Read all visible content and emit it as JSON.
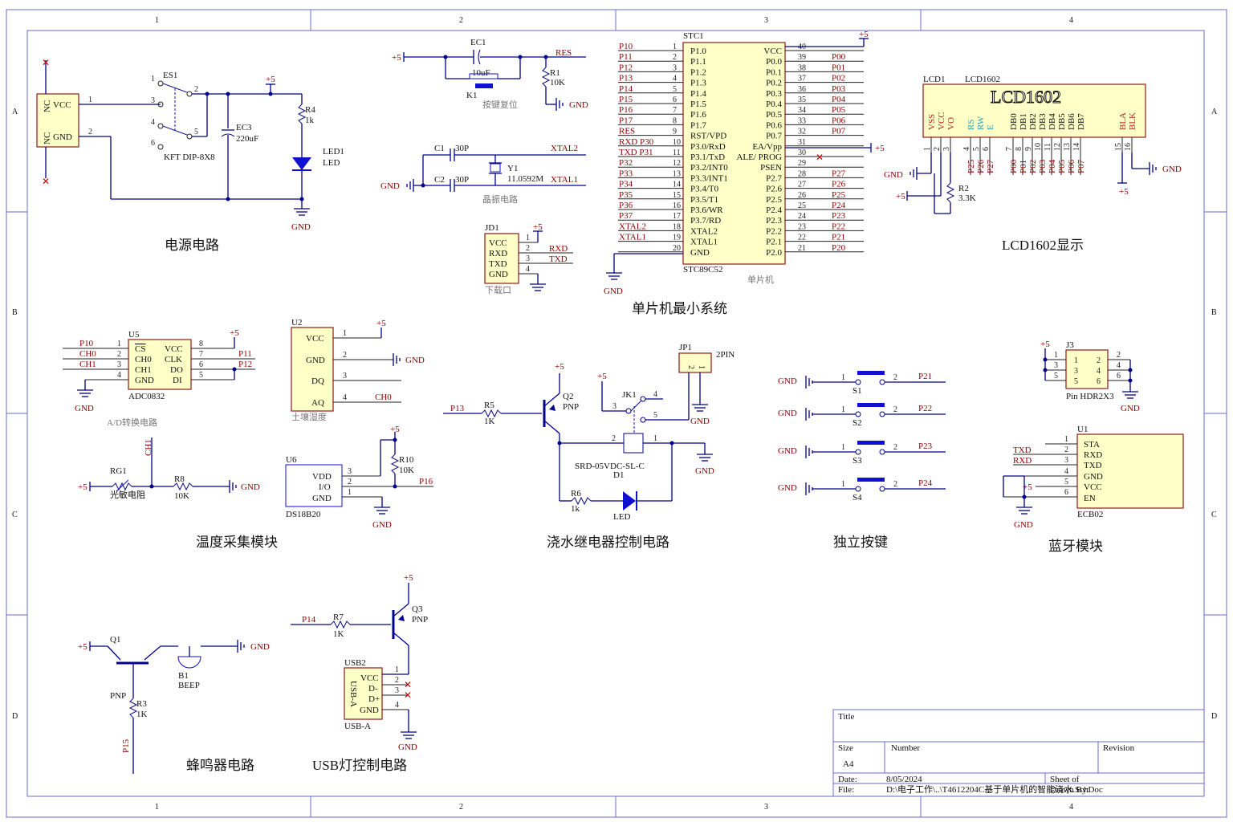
{
  "zones": {
    "cols": [
      "1",
      "2",
      "3",
      "4"
    ],
    "rows": [
      "A",
      "B",
      "C",
      "D"
    ]
  },
  "sections": {
    "power": "电源电路",
    "mcu": "单片机最小系统",
    "lcd": "LCD1602显示",
    "temp": "温度采集模块",
    "relay": "浇水继电器控制电路",
    "keys": "独立按键",
    "bt": "蓝牙模块",
    "buzzer": "蜂鸣器电路",
    "usb": "USB灯控制电路",
    "adc_hint": "A/D转换电路",
    "crystal_hint": "晶振电路",
    "reset_hint": "按键复位",
    "mcu_hint": "单片机",
    "download_hint": "下载口",
    "soil_hint": "土壤湿度"
  },
  "power": {
    "ES1": "ES1",
    "ES1_part": "KFT DIP-8X8",
    "conn_pins": [
      "VCC",
      "GND",
      "NC",
      "NC"
    ],
    "EC3": "EC3",
    "EC3_val": "220uF",
    "R4": "R4",
    "R4_val": "1k",
    "LED1": "LED1",
    "LED1_val": "LED",
    "plus5": "+5",
    "gnd": "GND"
  },
  "reset": {
    "EC1": "EC1",
    "EC1_val": "10uF",
    "K1": "K1",
    "R1": "R1",
    "R1_val": "10K",
    "res": "RES"
  },
  "crystal": {
    "C1": "C1",
    "C1_val": "30P",
    "C2": "C2",
    "C2_val": "30P",
    "Y1": "Y1",
    "Y1_val": "11.0592M",
    "xtal1": "XTAL1",
    "xtal2": "XTAL2"
  },
  "download": {
    "JD1": "JD1",
    "pins": [
      "VCC",
      "RXD",
      "TXD",
      "GND"
    ],
    "nets": [
      "RXD",
      "TXD"
    ]
  },
  "mcu": {
    "name": "STC1",
    "part": "STC89C52",
    "left_pins": [
      {
        "n": "1",
        "name": "P1.0",
        "net": "P10"
      },
      {
        "n": "2",
        "name": "P1.1",
        "net": "P11"
      },
      {
        "n": "3",
        "name": "P1.2",
        "net": "P12"
      },
      {
        "n": "4",
        "name": "P1.3",
        "net": "P13"
      },
      {
        "n": "5",
        "name": "P1.4",
        "net": "P14"
      },
      {
        "n": "6",
        "name": "P1.5",
        "net": "P15"
      },
      {
        "n": "7",
        "name": "P1.6",
        "net": "P16"
      },
      {
        "n": "8",
        "name": "P1.7",
        "net": "P17"
      },
      {
        "n": "9",
        "name": "RST/VPD",
        "net": "RES"
      },
      {
        "n": "10",
        "name": "P3.0/RxD",
        "net": "RXD P30"
      },
      {
        "n": "11",
        "name": "P3.1/TxD",
        "net": "TXD P31"
      },
      {
        "n": "12",
        "name": "P3.2/INT0",
        "net": "P32"
      },
      {
        "n": "13",
        "name": "P3.3/INT1",
        "net": "P33"
      },
      {
        "n": "14",
        "name": "P3.4/T0",
        "net": "P34"
      },
      {
        "n": "15",
        "name": "P3.5/T1",
        "net": "P35"
      },
      {
        "n": "16",
        "name": "P3.6/WR",
        "net": "P36"
      },
      {
        "n": "17",
        "name": "P3.7/RD",
        "net": "P37"
      },
      {
        "n": "18",
        "name": "XTAL2",
        "net": "XTAL2"
      },
      {
        "n": "19",
        "name": "XTAL1",
        "net": "XTAL1"
      },
      {
        "n": "20",
        "name": "GND",
        "net": ""
      }
    ],
    "right_pins": [
      {
        "n": "40",
        "name": "VCC",
        "net": ""
      },
      {
        "n": "39",
        "name": "P0.0",
        "net": "P00"
      },
      {
        "n": "38",
        "name": "P0.1",
        "net": "P01"
      },
      {
        "n": "37",
        "name": "P0.2",
        "net": "P02"
      },
      {
        "n": "36",
        "name": "P0.3",
        "net": "P03"
      },
      {
        "n": "35",
        "name": "P0.4",
        "net": "P04"
      },
      {
        "n": "34",
        "name": "P0.5",
        "net": "P05"
      },
      {
        "n": "33",
        "name": "P0.6",
        "net": "P06"
      },
      {
        "n": "32",
        "name": "P0.7",
        "net": "P07"
      },
      {
        "n": "31",
        "name": "EA/Vpp",
        "net": ""
      },
      {
        "n": "30",
        "name": "ALE/ PROG",
        "net": ""
      },
      {
        "n": "29",
        "name": "PSEN",
        "net": ""
      },
      {
        "n": "28",
        "name": "P2.7",
        "net": "P27"
      },
      {
        "n": "27",
        "name": "P2.6",
        "net": "P26"
      },
      {
        "n": "26",
        "name": "P2.5",
        "net": "P25"
      },
      {
        "n": "25",
        "name": "P2.4",
        "net": "P24"
      },
      {
        "n": "24",
        "name": "P2.3",
        "net": "P23"
      },
      {
        "n": "23",
        "name": "P2.2",
        "net": "P22"
      },
      {
        "n": "22",
        "name": "P2.1",
        "net": "P21"
      },
      {
        "n": "21",
        "name": "P2.0",
        "net": "P20"
      }
    ]
  },
  "lcd": {
    "ref": "LCD1",
    "part": "LCD1602",
    "logo": "LCD1602",
    "pins": [
      {
        "n": "1",
        "name": "VSS",
        "net": ""
      },
      {
        "n": "2",
        "name": "VCC",
        "net": ""
      },
      {
        "n": "3",
        "name": "VO",
        "net": ""
      },
      {
        "n": "4",
        "name": "RS",
        "net": "P25"
      },
      {
        "n": "5",
        "name": "RW",
        "net": "P26"
      },
      {
        "n": "6",
        "name": "E",
        "net": "P27"
      },
      {
        "n": "7",
        "name": "DB0",
        "net": "P00"
      },
      {
        "n": "8",
        "name": "DB1",
        "net": "P01"
      },
      {
        "n": "9",
        "name": "DB2",
        "net": "P02"
      },
      {
        "n": "10",
        "name": "DB3",
        "net": "P03"
      },
      {
        "n": "11",
        "name": "DB4",
        "net": "P04"
      },
      {
        "n": "12",
        "name": "DB5",
        "net": "P05"
      },
      {
        "n": "13",
        "name": "DB6",
        "net": "P06"
      },
      {
        "n": "14",
        "name": "DB7",
        "net": "P07"
      },
      {
        "n": "15",
        "name": "BLA",
        "net": ""
      },
      {
        "n": "16",
        "name": "BLK",
        "net": ""
      }
    ],
    "R2": "R2",
    "R2_val": "3.3K"
  },
  "adc": {
    "ref": "U5",
    "part": "ADC0832",
    "left": [
      "CS",
      "CH0",
      "CH1",
      "GND"
    ],
    "right": [
      "VCC",
      "CLK",
      "DO",
      "DI"
    ],
    "lnets": [
      "P10",
      "CH0",
      "CH1"
    ],
    "rnets": [
      "P11",
      "P12"
    ]
  },
  "soil": {
    "ref": "U2",
    "pins": [
      "VCC",
      "GND",
      "DQ",
      "AQ"
    ],
    "net": "CH0"
  },
  "ldr": {
    "RG1": "RG1",
    "RG1_val": "光敏电阻",
    "R8": "R8",
    "R8_val": "10K",
    "net": "CH1"
  },
  "ds18": {
    "ref": "U6",
    "part": "DS18B20",
    "pins": [
      "VDD",
      "I/O",
      "GND"
    ],
    "R10": "R10",
    "R10_val": "10K",
    "net": "P16"
  },
  "relay": {
    "Q2": "Q2",
    "Q2_type": "PNP",
    "R5": "R5",
    "R5_val": "1K",
    "net_in": "P13",
    "JK1": "JK1",
    "relay_part": "SRD-05VDC-SL-C",
    "D1": "D1",
    "R6": "R6",
    "R6_val": "1k",
    "led": "LED",
    "JP1": "JP1",
    "JP1_val": "2PIN"
  },
  "keys": [
    {
      "ref": "S1",
      "net": "P21"
    },
    {
      "ref": "S2",
      "net": "P22"
    },
    {
      "ref": "S3",
      "net": "P23"
    },
    {
      "ref": "S4",
      "net": "P24"
    }
  ],
  "j3": {
    "ref": "J3",
    "part": "Pin HDR2X3",
    "pins": [
      "1",
      "2",
      "3",
      "4",
      "5",
      "6"
    ]
  },
  "bt": {
    "ref": "U1",
    "part": "ECB02",
    "pins": [
      "STA",
      "RXD",
      "TXD",
      "GND",
      "VCC",
      "EN"
    ],
    "nets": [
      "TXD",
      "RXD"
    ]
  },
  "buzzer": {
    "Q1": "Q1",
    "Q1_type": "PNP",
    "R3": "R3",
    "R3_val": "1K",
    "B1": "B1",
    "B1_val": "BEEP",
    "net": "P15"
  },
  "usb": {
    "Q3": "Q3",
    "Q3_type": "PNP",
    "R7": "R7",
    "R7_val": "1K",
    "net": "P14",
    "ref": "USB2",
    "part": "USB-A",
    "body": "USB-A",
    "pins": [
      "VCC",
      "D-",
      "D+",
      "GND"
    ]
  },
  "titleblock": {
    "title": "Title",
    "size_l": "Size",
    "size": "A4",
    "number_l": "Number",
    "revision_l": "Revision",
    "date_l": "Date:",
    "date": "8/05/2024",
    "sheet_l": "Sheet  of",
    "file_l": "File:",
    "file": "D:\\电子工作\\..\\T4612204C基于单片机的智能浇水.SchDoc",
    "drawn": "Drawn By:"
  },
  "colors": {
    "wire": "#00008b",
    "chip_fill": "#ffffc8",
    "chip_border": "#8b1a1a",
    "net": "#8b0000",
    "border": "#6a6ad0"
  }
}
